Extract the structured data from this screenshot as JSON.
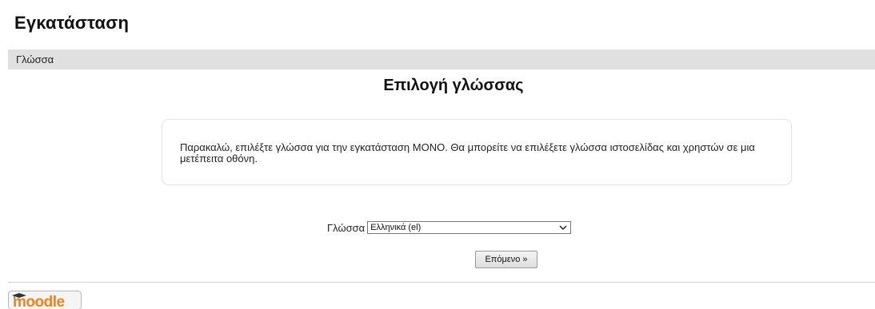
{
  "header": {
    "title": "Εγκατάσταση"
  },
  "navbar": {
    "breadcrumb": "Γλώσσα"
  },
  "main": {
    "heading": "Επιλογή γλώσσας",
    "info_text": "Παρακαλώ, επιλέξτε γλώσσα για την εγκατάσταση MONO. Θα μπορείτε να επιλέξετε γλώσσα ιστοσελίδας και χρηστών σε μια μετέπειτα οθόνη.",
    "language_label": "Γλώσσα",
    "language_selected": "Ελληνικά (el)",
    "next_button": "Επόμενο »"
  },
  "footer": {
    "logo_text": "moodle",
    "logo_icon": "graduation-cap-icon"
  },
  "colors": {
    "navbar_bg": "#e0e0e0",
    "logo_orange": "#f98012",
    "logo_dark": "#333333"
  }
}
